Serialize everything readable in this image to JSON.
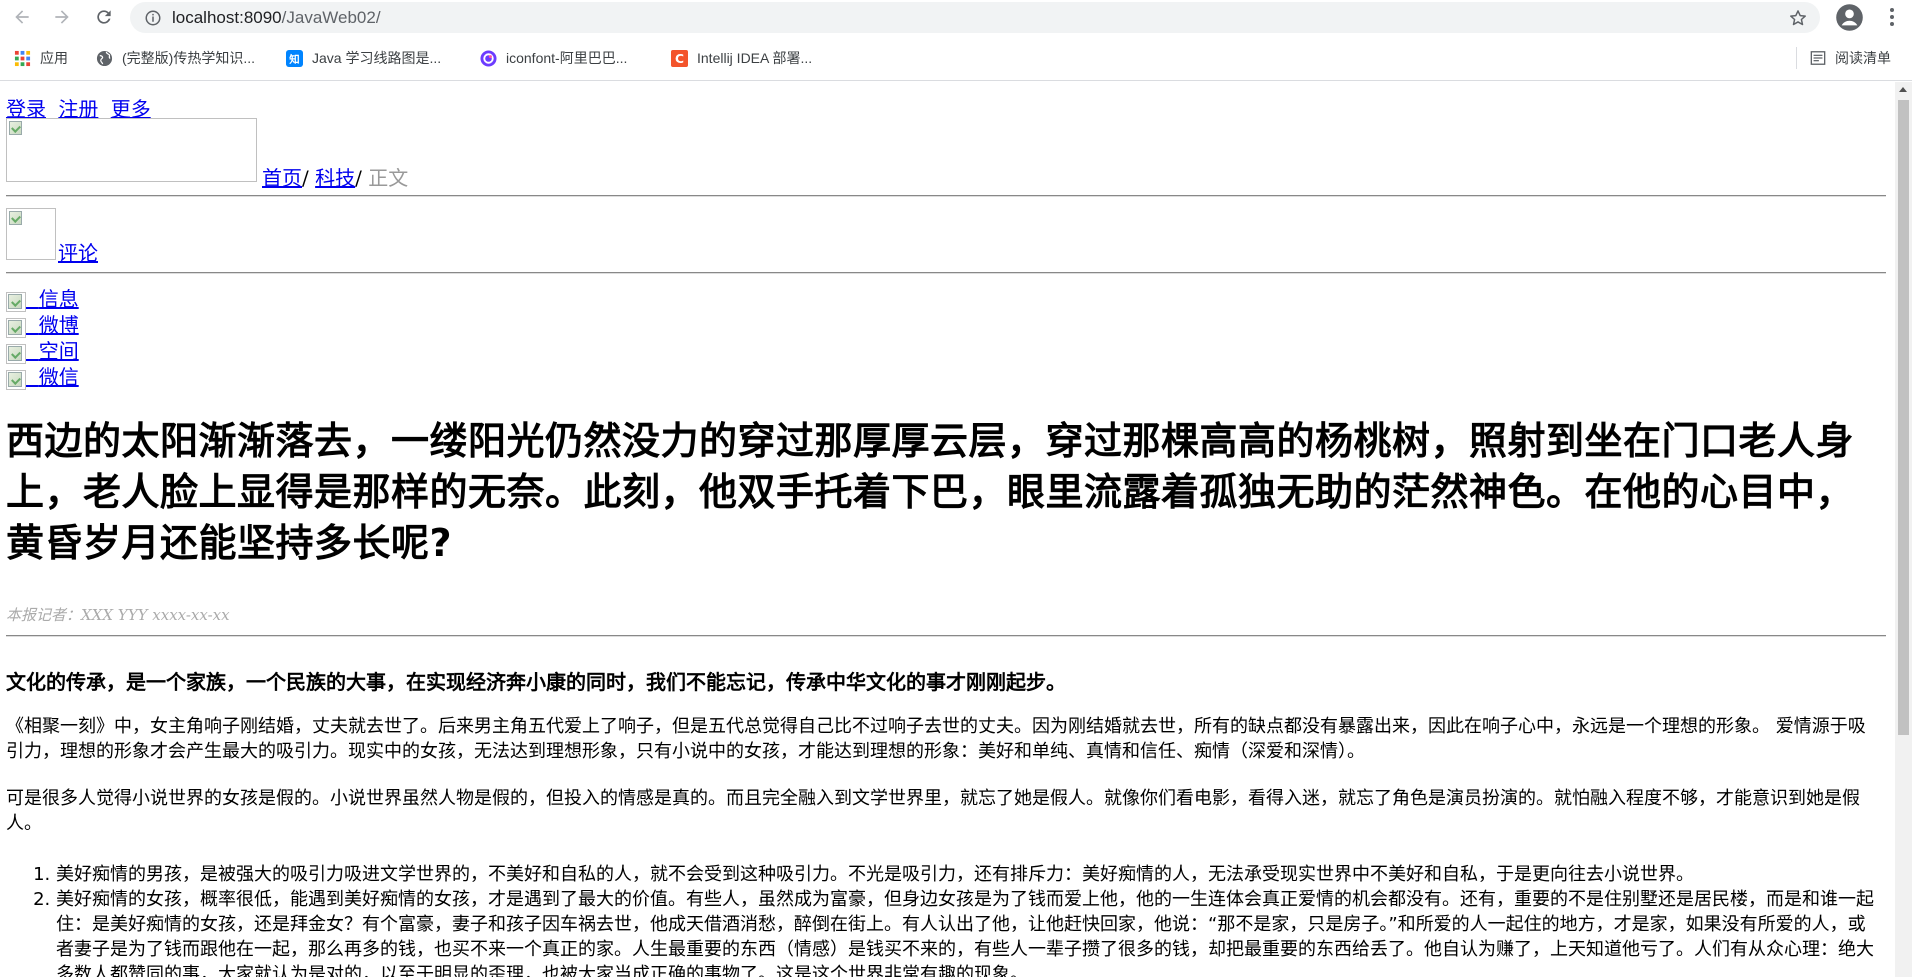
{
  "browser": {
    "url_host": "localhost:8090",
    "url_path": "/JavaWeb02/",
    "bookmarks": [
      {
        "label": "应用",
        "icon": "apps-grid-icon"
      },
      {
        "label": "(完整版)传热学知识...",
        "icon": "globe-icon"
      },
      {
        "label": "Java 学习线路图是...",
        "icon": "zhihu-icon"
      },
      {
        "label": "iconfont-阿里巴巴...",
        "icon": "iconfont-icon"
      },
      {
        "label": "Intellij IDEA 部署...",
        "icon": "csdn-icon"
      }
    ],
    "reading_list": "阅读清单"
  },
  "page": {
    "topnav": [
      "登录",
      "注册",
      "更多"
    ],
    "breadcrumb": {
      "home": "首页",
      "sep": "/",
      "category": "科技",
      "current": "正文"
    },
    "comment": "评论",
    "share": [
      "信息",
      "微博",
      "空间",
      "微信"
    ],
    "headline": "西边的太阳渐渐落去，一缕阳光仍然没力的穿过那厚厚云层，穿过那棵高高的杨桃树，照射到坐在门口老人身上，老人脸上显得是那样的无奈。此刻，他双手托着下巴，眼里流露着孤独无助的茫然神色。在他的心目中，黄昏岁月还能坚持多长呢?",
    "byline": "本报记者：XXX YYY xxxx-xx-xx",
    "lead": "文化的传承，是一个家族，一个民族的大事，在实现经济奔小康的同时，我们不能忘记，传承中华文化的事才刚刚起步。",
    "paragraphs": [
      "《相聚一刻》中，女主角响子刚结婚，丈夫就去世了。后来男主角五代爱上了响子，但是五代总觉得自己比不过响子去世的丈夫。因为刚结婚就去世，所有的缺点都没有暴露出来，因此在响子心中，永远是一个理想的形象。 爱情源于吸引力，理想的形象才会产生最大的吸引力。现实中的女孩，无法达到理想形象，只有小说中的女孩，才能达到理想的形象：美好和单纯、真情和信任、痴情（深爱和深情）。",
      "可是很多人觉得小说世界的女孩是假的。小说世界虽然人物是假的，但投入的情感是真的。而且完全融入到文学世界里，就忘了她是假人。就像你们看电影，看得入迷，就忘了角色是演员扮演的。就怕融入程度不够，才能意识到她是假人。"
    ],
    "list": [
      "美好痴情的男孩，是被强大的吸引力吸进文学世界的，不美好和自私的人，就不会受到这种吸引力。不光是吸引力，还有排斥力：美好痴情的人，无法承受现实世界中不美好和自私，于是更向往去小说世界。",
      "美好痴情的女孩，概率很低，能遇到美好痴情的女孩，才是遇到了最大的价值。有些人，虽然成为富豪，但身边女孩是为了钱而爱上他，他的一生连体会真正爱情的机会都没有。还有，重要的不是住别墅还是居民楼，而是和谁一起住：是美好痴情的女孩，还是拜金女？有个富豪，妻子和孩子因车祸去世，他成天借酒消愁，醉倒在街上。有人认出了他，让他赶快回家，他说：“那不是家，只是房子。”和所爱的人一起住的地方，才是家，如果没有所爱的人，或者妻子是为了钱而跟他在一起，那么再多的钱，也买不来一个真正的家。人生最重要的东西（情感）是钱买不来的，有些人一辈子攒了很多的钱，却把最重要的东西给丢了。他自认为赚了，上天知道他亏了。人们有从众心理：绝大多数人都赞同的事，大家就认为是对的，以至于明显的歪理，也被大家当成正确的事物了。这是这个世界非常有趣的现象。"
    ]
  }
}
